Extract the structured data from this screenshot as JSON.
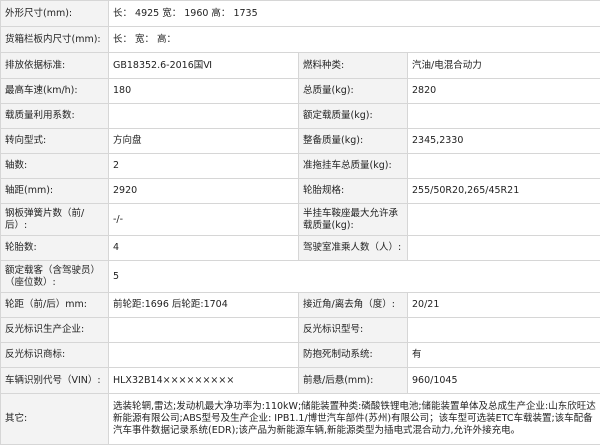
{
  "rows": {
    "r0": {
      "l1": "外形尺寸(mm):",
      "v1": "长： 4925 宽： 1960 高： 1735"
    },
    "r1": {
      "l1": "货箱栏板内尺寸(mm):",
      "v1": "长：  宽：  高："
    },
    "r2": {
      "l1": "排放依据标准:",
      "v1": "GB18352.6-2016国Ⅵ",
      "l2": "燃料种类:",
      "v2": "汽油/电混合动力"
    },
    "r3": {
      "l1": "最高车速(km/h):",
      "v1": "180",
      "l2": "总质量(kg):",
      "v2": "2820"
    },
    "r4": {
      "l1": "载质量利用系数:",
      "v1": "",
      "l2": "额定载质量(kg):",
      "v2": ""
    },
    "r5": {
      "l1": "转向型式:",
      "v1": "方向盘",
      "l2": "整备质量(kg):",
      "v2": "2345,2330"
    },
    "r6": {
      "l1": "轴数:",
      "v1": "2",
      "l2": "准拖挂车总质量(kg):",
      "v2": ""
    },
    "r7": {
      "l1": "轴距(mm):",
      "v1": "2920",
      "l2": "轮胎规格:",
      "v2": "255/50R20,265/45R21"
    },
    "r8": {
      "l1": "钢板弹簧片数（前/后）:",
      "v1": "-/-",
      "l2": "半挂车鞍座最大允许承载质量(kg):",
      "v2": ""
    },
    "r9": {
      "l1": "轮胎数:",
      "v1": "4",
      "l2": "驾驶室准乘人数（人）:",
      "v2": ""
    },
    "r10": {
      "l1": "额定载客（含驾驶员）（座位数）:",
      "v1": "5"
    },
    "r11": {
      "l1": "轮距（前/后）mm:",
      "v1": "前轮距:1696 后轮距:1704",
      "l2": "接近角/离去角（度）:",
      "v2": "20/21"
    },
    "r12": {
      "l1": "反光标识生产企业:",
      "v1": "",
      "l2": "反光标识型号:",
      "v2": ""
    },
    "r13": {
      "l1": "反光标识商标:",
      "v1": "",
      "l2": "防抱死制动系统:",
      "v2": "有"
    },
    "r14": {
      "l1": "车辆识别代号（VIN）:",
      "v1": "HLX32B14×××××××××",
      "l2": "前悬/后悬(mm):",
      "v2": "960/1045"
    },
    "r15": {
      "l1": "其它:",
      "v1": "选装轮辋,雷达;发动机最大净功率为:110kW;储能装置种类:磷酸铁锂电池;储能装置单体及总成生产企业:山东欣旺达新能源有限公司;ABS型号及生产企业: IPB1.1/博世汽车部件(苏州)有限公司；该车型可选装ETC车载装置;该车配备汽车事件数据记录系统(EDR);该产品为新能源车辆,新能源类型为插电式混合动力,允许外接充电。"
    }
  }
}
